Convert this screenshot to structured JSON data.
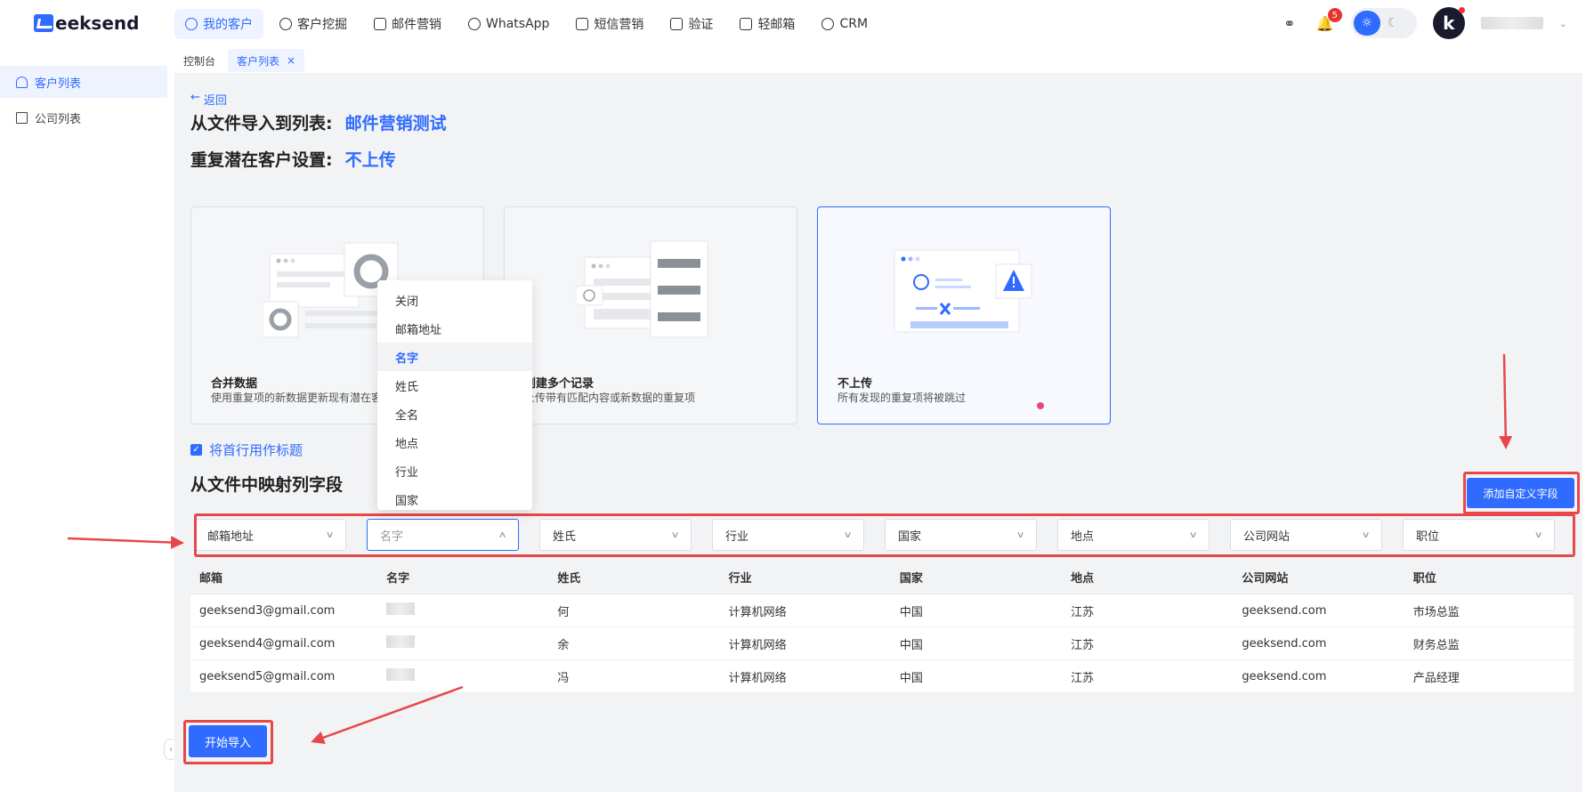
{
  "brand": {
    "name": "Geeksend",
    "logo_rest": "eeksend"
  },
  "nav": [
    {
      "label": "我的客户",
      "icon": "user-icon",
      "active": true
    },
    {
      "label": "客户挖掘",
      "icon": "search-icon"
    },
    {
      "label": "邮件营销",
      "icon": "mail-icon"
    },
    {
      "label": "WhatsApp",
      "icon": "whatsapp-icon"
    },
    {
      "label": "短信营销",
      "icon": "sms-icon"
    },
    {
      "label": "验证",
      "icon": "verify-icon"
    },
    {
      "label": "轻邮箱",
      "icon": "light-mail-icon"
    },
    {
      "label": "CRM",
      "icon": "crm-icon"
    }
  ],
  "header": {
    "notifications_count": "5",
    "avatar_letter": "k"
  },
  "tabs": [
    {
      "label": "控制台"
    },
    {
      "label": "客户列表",
      "close": "×",
      "active": true
    }
  ],
  "sidebar": {
    "items": [
      {
        "label": "客户列表",
        "icon": "user-icon",
        "active": true
      },
      {
        "label": "公司列表",
        "icon": "building-icon"
      }
    ]
  },
  "page": {
    "back_label": "返回",
    "import_label": "从文件导入到列表:",
    "import_list": "邮件营销测试",
    "dup_label": "重复潜在客户设置:",
    "dup_value": "不上传",
    "first_row_header_label": "将首行用作标题",
    "map_title": "从文件中映射列字段",
    "add_field_button": "添加自定义字段",
    "start_button": "开始导入"
  },
  "cards": [
    {
      "title": "合并数据",
      "desc": "使用重复项的新数据更新现有潜在客户"
    },
    {
      "title": "创建多个记录",
      "desc": "上传带有匹配内容或新数据的重复项"
    },
    {
      "title": "不上传",
      "desc": "所有发现的重复项将被跳过",
      "selected": true
    }
  ],
  "mapping_selects": [
    {
      "value": "邮箱地址"
    },
    {
      "value": "名字",
      "open": true
    },
    {
      "value": "姓氏"
    },
    {
      "value": "行业"
    },
    {
      "value": "国家"
    },
    {
      "value": "地点"
    },
    {
      "value": "公司网站"
    },
    {
      "value": "职位"
    }
  ],
  "dropdown_options": [
    "关闭",
    "邮箱地址",
    "名字",
    "姓氏",
    "全名",
    "地点",
    "行业",
    "国家"
  ],
  "dropdown_selected": "名字",
  "table": {
    "headers": [
      "邮箱",
      "名字",
      "姓氏",
      "行业",
      "国家",
      "地点",
      "公司网站",
      "职位"
    ],
    "rows": [
      [
        "geeksend3@gmail.com",
        "",
        "何",
        "计算机网络",
        "中国",
        "江苏",
        "geeksend.com",
        "市场总监"
      ],
      [
        "geeksend4@gmail.com",
        "",
        "余",
        "计算机网络",
        "中国",
        "江苏",
        "geeksend.com",
        "财务总监"
      ],
      [
        "geeksend5@gmail.com",
        "",
        "冯",
        "计算机网络",
        "中国",
        "江苏",
        "geeksend.com",
        "产品经理"
      ]
    ]
  },
  "colors": {
    "accent": "#2f6bff",
    "annotation_red": "#e8474a",
    "badge_red": "#e8322e"
  }
}
